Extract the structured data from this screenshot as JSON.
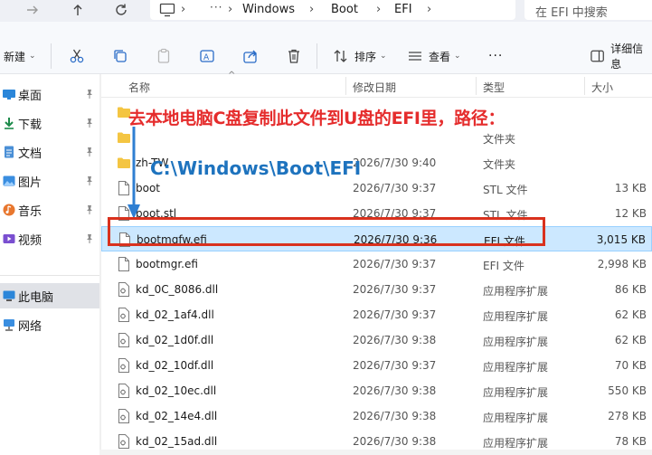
{
  "address_bar": {
    "breadcrumbs": [
      "Windows",
      "Boot",
      "EFI"
    ],
    "more": "···",
    "search_placeholder": "在 EFI 中搜索"
  },
  "ribbon": {
    "new_label": "新建",
    "sort_label": "排序",
    "view_label": "查看",
    "details_label": "详细信息"
  },
  "sidebar": {
    "items": [
      {
        "label": "桌面",
        "icon": "desktop-icon",
        "pinned": true
      },
      {
        "label": "下载",
        "icon": "download-icon",
        "pinned": true
      },
      {
        "label": "文档",
        "icon": "document-icon",
        "pinned": true
      },
      {
        "label": "图片",
        "icon": "picture-icon",
        "pinned": true
      },
      {
        "label": "音乐",
        "icon": "music-icon",
        "pinned": true
      },
      {
        "label": "视频",
        "icon": "video-icon",
        "pinned": true
      },
      {
        "label": "此电脑",
        "icon": "this-pc-icon",
        "pinned": false,
        "selected": true
      },
      {
        "label": "网络",
        "icon": "network-icon",
        "pinned": false
      }
    ]
  },
  "columns": {
    "name": "名称",
    "date": "修改日期",
    "type": "类型",
    "size": "大小"
  },
  "files": [
    {
      "name": "",
      "date": "",
      "type": "",
      "size": "",
      "kind": "folder"
    },
    {
      "name": "",
      "date": "",
      "type": "文件夹",
      "size": "",
      "kind": "folder"
    },
    {
      "name": "zh-TW",
      "date": "2026/7/30 9:40",
      "type": "文件夹",
      "size": "",
      "kind": "folder"
    },
    {
      "name": "boot",
      "date": "2026/7/30 9:37",
      "type": "STL 文件",
      "size": "13 KB",
      "kind": "file"
    },
    {
      "name": "boot.stl",
      "date": "2026/7/30 9:37",
      "type": "STL 文件",
      "size": "12 KB",
      "kind": "file"
    },
    {
      "name": "bootmgfw.efi",
      "date": "2026/7/30 9:36",
      "type": "EFI 文件",
      "size": "3,015 KB",
      "kind": "file",
      "selected": true
    },
    {
      "name": "bootmgr.efi",
      "date": "2026/7/30 9:37",
      "type": "EFI 文件",
      "size": "2,998 KB",
      "kind": "file"
    },
    {
      "name": "kd_0C_8086.dll",
      "date": "2026/7/30 9:37",
      "type": "应用程序扩展",
      "size": "86 KB",
      "kind": "dll"
    },
    {
      "name": "kd_02_1af4.dll",
      "date": "2026/7/30 9:37",
      "type": "应用程序扩展",
      "size": "62 KB",
      "kind": "dll"
    },
    {
      "name": "kd_02_1d0f.dll",
      "date": "2026/7/30 9:38",
      "type": "应用程序扩展",
      "size": "62 KB",
      "kind": "dll"
    },
    {
      "name": "kd_02_10df.dll",
      "date": "2026/7/30 9:37",
      "type": "应用程序扩展",
      "size": "70 KB",
      "kind": "dll"
    },
    {
      "name": "kd_02_10ec.dll",
      "date": "2026/7/30 9:38",
      "type": "应用程序扩展",
      "size": "550 KB",
      "kind": "dll"
    },
    {
      "name": "kd_02_14e4.dll",
      "date": "2026/7/30 9:38",
      "type": "应用程序扩展",
      "size": "278 KB",
      "kind": "dll"
    },
    {
      "name": "kd_02_15ad.dll",
      "date": "2026/7/30 9:38",
      "type": "应用程序扩展",
      "size": "78 KB",
      "kind": "dll"
    }
  ],
  "annotation": {
    "instruction": "去本地电脑C盘复制此文件到U盘的EFI里，路径：",
    "path": "C:\\Windows\\Boot\\EFI",
    "title_color": "#e52c2c",
    "path_color": "#1e73be",
    "box_color": "#d9311d"
  }
}
